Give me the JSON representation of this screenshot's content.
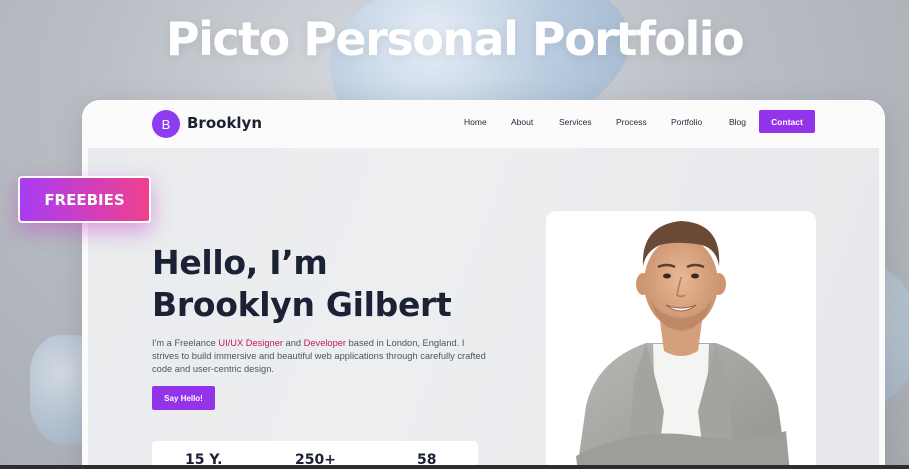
{
  "headline": "Picto Personal Portfolio",
  "badge": "FREEBIES",
  "site": {
    "logo_letter": "B",
    "brand": "Brooklyn",
    "nav": [
      "Home",
      "About",
      "Services",
      "Process",
      "Portfolio",
      "Blog"
    ],
    "contact_label": "Contact"
  },
  "hero": {
    "title_line1": "Hello, I’m",
    "title_line2": "Brooklyn Gilbert",
    "desc_prefix": "I'm a Freelance ",
    "desc_role1": "UI/UX Designer",
    "desc_and": " and ",
    "desc_role2": "Developer",
    "desc_suffix": " based in London, England. I strives to build immersive and beautiful web applications through carefully crafted code and user-centric design.",
    "cta_label": "Say Hello!",
    "stats": [
      "15 Y.",
      "250+",
      "58"
    ]
  },
  "colors": {
    "accent": "#9333ea",
    "badge_gradient_start": "#a93cf3",
    "badge_gradient_end": "#f0408e",
    "heading": "#1b2235"
  },
  "icons": [
    "person-photo"
  ]
}
